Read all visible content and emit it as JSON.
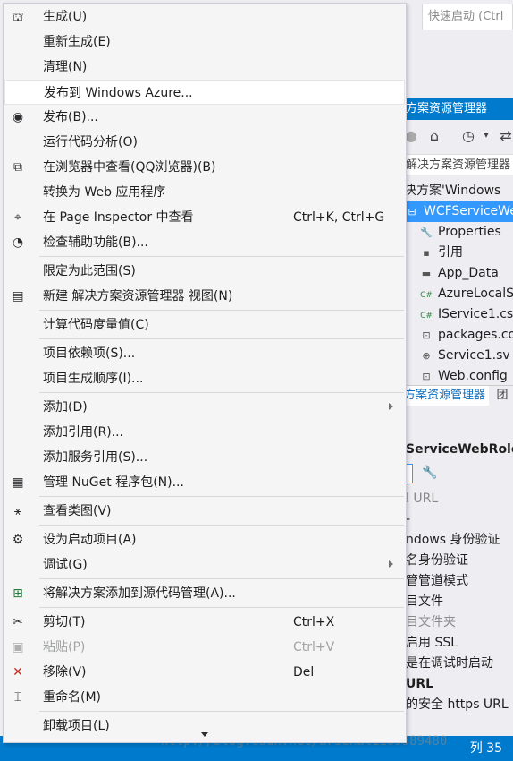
{
  "quick_launch": {
    "placeholder": "快速启动 (Ctrl"
  },
  "solution_explorer": {
    "title": "方案资源管理器",
    "search_text": "解决方案资源管理器",
    "tree": [
      {
        "label": "决方案'Windows",
        "icon": "solution-icon",
        "selected": false
      },
      {
        "label": "WCFServiceWe",
        "icon": "cloud-project-icon",
        "selected": true
      },
      {
        "label": "Properties",
        "icon": "wrench-icon",
        "selected": false
      },
      {
        "label": "引用",
        "icon": "references-icon",
        "selected": false
      },
      {
        "label": "App_Data",
        "icon": "folder-icon",
        "selected": false
      },
      {
        "label": "AzureLocalS",
        "icon": "csharp-file-icon",
        "selected": false
      },
      {
        "label": "IService1.cs",
        "icon": "csharp-file-icon",
        "selected": false
      },
      {
        "label": "packages.co",
        "icon": "config-file-icon",
        "selected": false
      },
      {
        "label": "Service1.sv",
        "icon": "service-file-icon",
        "selected": false
      },
      {
        "label": "Web.config",
        "icon": "config-file-icon",
        "selected": false
      }
    ],
    "tabs": [
      {
        "label": "方案资源管理器",
        "active": true
      },
      {
        "label": "团",
        "active": false
      }
    ]
  },
  "properties": {
    "title": "ServiceWebRole",
    "rows": [
      {
        "label": "l URL",
        "style": "gray"
      },
      {
        "label": "-",
        "style": "normal"
      },
      {
        "label": "ndows 身份验证",
        "style": "normal"
      },
      {
        "label": "名身份验证",
        "style": "normal"
      },
      {
        "label": "管管道模式",
        "style": "normal"
      },
      {
        "label": "目文件",
        "style": "normal"
      },
      {
        "label": "目文件夹",
        "style": "gray"
      },
      {
        "label": "启用 SSL",
        "style": "normal"
      },
      {
        "label": "是在调试时启动",
        "style": "normal"
      },
      {
        "label": "URL",
        "style": "cat"
      },
      {
        "label": "的安全 https URL",
        "style": "normal"
      }
    ]
  },
  "status_bar": {
    "column": "列 35",
    "color": "#007acc"
  },
  "watermark": "http://blog.csdn.net/arsenal1109389480",
  "menu": {
    "items": [
      {
        "label": "生成(U)",
        "icon": "build-icon",
        "glyph": "⛫",
        "shortcut": "",
        "submenu": false,
        "disabled": false,
        "hover": false
      },
      {
        "label": "重新生成(E)",
        "icon": "",
        "glyph": "",
        "shortcut": "",
        "submenu": false,
        "disabled": false,
        "hover": false
      },
      {
        "label": "清理(N)",
        "icon": "",
        "glyph": "",
        "shortcut": "",
        "submenu": false,
        "disabled": false,
        "hover": false
      },
      {
        "label": "发布到 Windows Azure...",
        "icon": "",
        "glyph": "",
        "shortcut": "",
        "submenu": false,
        "disabled": false,
        "hover": true
      },
      {
        "label": "发布(B)...",
        "icon": "publish-globe-icon",
        "glyph": "◉",
        "shortcut": "",
        "submenu": false,
        "disabled": false,
        "hover": false
      },
      {
        "label": "运行代码分析(O)",
        "icon": "",
        "glyph": "",
        "shortcut": "",
        "submenu": false,
        "disabled": false,
        "hover": false
      },
      {
        "label": "在浏览器中查看(QQ浏览器)(B)",
        "icon": "browser-view-icon",
        "glyph": "⧉",
        "shortcut": "",
        "submenu": false,
        "disabled": false,
        "hover": false
      },
      {
        "label": "转换为 Web 应用程序",
        "icon": "",
        "glyph": "",
        "shortcut": "",
        "submenu": false,
        "disabled": false,
        "hover": false
      },
      {
        "label": "在 Page Inspector 中查看",
        "icon": "page-inspector-icon",
        "glyph": "⌖",
        "shortcut": "Ctrl+K, Ctrl+G",
        "submenu": false,
        "disabled": false,
        "hover": false
      },
      {
        "label": "检查辅助功能(B)...",
        "icon": "accessibility-icon",
        "glyph": "◔",
        "shortcut": "",
        "submenu": false,
        "disabled": false,
        "hover": false
      },
      {
        "label": "限定为此范围(S)",
        "icon": "",
        "glyph": "",
        "shortcut": "",
        "submenu": false,
        "disabled": false,
        "hover": false
      },
      {
        "label": "新建 解决方案资源管理器 视图(N)",
        "icon": "new-view-icon",
        "glyph": "▤",
        "shortcut": "",
        "submenu": false,
        "disabled": false,
        "hover": false
      },
      {
        "label": "计算代码度量值(C)",
        "icon": "",
        "glyph": "",
        "shortcut": "",
        "submenu": false,
        "disabled": false,
        "hover": false
      },
      {
        "label": "项目依赖项(S)...",
        "icon": "",
        "glyph": "",
        "shortcut": "",
        "submenu": false,
        "disabled": false,
        "hover": false
      },
      {
        "label": "项目生成顺序(I)...",
        "icon": "",
        "glyph": "",
        "shortcut": "",
        "submenu": false,
        "disabled": false,
        "hover": false
      },
      {
        "label": "添加(D)",
        "icon": "",
        "glyph": "",
        "shortcut": "",
        "submenu": true,
        "disabled": false,
        "hover": false
      },
      {
        "label": "添加引用(R)...",
        "icon": "",
        "glyph": "",
        "shortcut": "",
        "submenu": false,
        "disabled": false,
        "hover": false
      },
      {
        "label": "添加服务引用(S)...",
        "icon": "",
        "glyph": "",
        "shortcut": "",
        "submenu": false,
        "disabled": false,
        "hover": false
      },
      {
        "label": "管理 NuGet 程序包(N)...",
        "icon": "nuget-package-icon",
        "glyph": "▦",
        "shortcut": "",
        "submenu": false,
        "disabled": false,
        "hover": false
      },
      {
        "label": "查看类图(V)",
        "icon": "class-diagram-icon",
        "glyph": "⚹",
        "shortcut": "",
        "submenu": false,
        "disabled": false,
        "hover": false
      },
      {
        "label": "设为启动项目(A)",
        "icon": "gear-icon",
        "glyph": "⚙",
        "shortcut": "",
        "submenu": false,
        "disabled": false,
        "hover": false
      },
      {
        "label": "调试(G)",
        "icon": "",
        "glyph": "",
        "shortcut": "",
        "submenu": true,
        "disabled": false,
        "hover": false
      },
      {
        "label": "将解决方案添加到源代码管理(A)...",
        "icon": "source-control-add-icon",
        "glyph": "⊞",
        "shortcut": "",
        "submenu": false,
        "disabled": false,
        "hover": false
      },
      {
        "label": "剪切(T)",
        "icon": "scissors-icon",
        "glyph": "✂",
        "shortcut": "Ctrl+X",
        "submenu": false,
        "disabled": false,
        "hover": false
      },
      {
        "label": "粘贴(P)",
        "icon": "paste-icon",
        "glyph": "▣",
        "shortcut": "Ctrl+V",
        "submenu": false,
        "disabled": true,
        "hover": false
      },
      {
        "label": "移除(V)",
        "icon": "remove-x-icon",
        "glyph": "✕",
        "shortcut": "Del",
        "submenu": false,
        "disabled": false,
        "hover": false
      },
      {
        "label": "重命名(M)",
        "icon": "rename-icon",
        "glyph": "⌶",
        "shortcut": "",
        "submenu": false,
        "disabled": false,
        "hover": false
      },
      {
        "label": "卸载项目(L)",
        "icon": "",
        "glyph": "",
        "shortcut": "",
        "submenu": false,
        "disabled": false,
        "hover": false
      }
    ]
  }
}
